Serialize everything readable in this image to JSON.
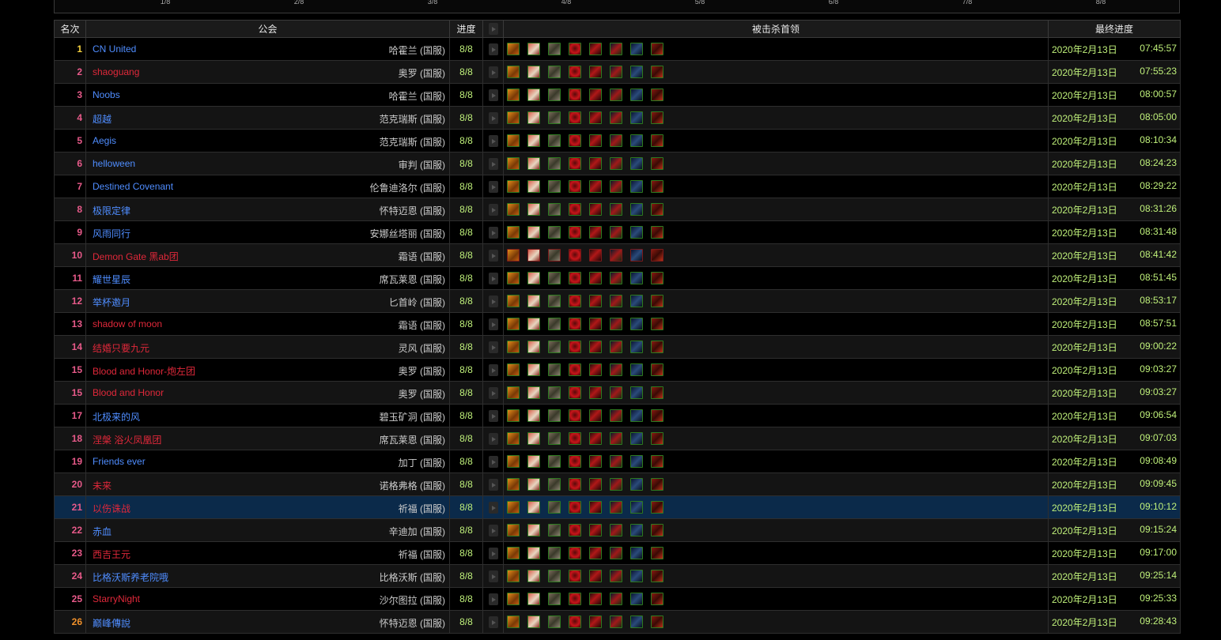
{
  "progress_labels": [
    "1/8",
    "2/8",
    "3/8",
    "4/8",
    "5/8",
    "6/8",
    "7/8",
    "8/8"
  ],
  "headers": {
    "rank": "名次",
    "guild": "公会",
    "progress": "进度",
    "video_icon": "youtube-icon",
    "bosses": "被击杀首领",
    "final": "最终进度"
  },
  "colors": {
    "alliance": "#4f8dff",
    "horde": "#e0283a",
    "progress": "#bff07a",
    "highlight_row": "#0b2a4a"
  },
  "boss_icon_names": [
    "boss-1-icon",
    "boss-2-icon",
    "boss-3-icon",
    "boss-4-icon",
    "boss-5-icon",
    "boss-6-icon",
    "boss-7-icon",
    "boss-8-icon"
  ],
  "rows": [
    {
      "rank": "1",
      "rank_color": "#f4d03f",
      "guild": "CN United",
      "faction": "alliance",
      "realm": "哈霍兰 (国服)",
      "progress": "8/8",
      "date": "2020年2月13日",
      "time": "07:45:57"
    },
    {
      "rank": "2",
      "rank_color": "#e85a8a",
      "guild": "shaoguang",
      "faction": "horde",
      "realm": "奥罗 (国服)",
      "progress": "8/8",
      "date": "2020年2月13日",
      "time": "07:55:23"
    },
    {
      "rank": "3",
      "rank_color": "#e85a8a",
      "guild": "Noobs",
      "faction": "alliance",
      "realm": "哈霍兰 (国服)",
      "progress": "8/8",
      "date": "2020年2月13日",
      "time": "08:00:57"
    },
    {
      "rank": "4",
      "rank_color": "#e85a8a",
      "guild": "超越",
      "faction": "alliance",
      "realm": "范克瑞斯 (国服)",
      "progress": "8/8",
      "date": "2020年2月13日",
      "time": "08:05:00"
    },
    {
      "rank": "5",
      "rank_color": "#e85a8a",
      "guild": "Aegis",
      "faction": "alliance",
      "realm": "范克瑞斯 (国服)",
      "progress": "8/8",
      "date": "2020年2月13日",
      "time": "08:10:34"
    },
    {
      "rank": "6",
      "rank_color": "#e85a8a",
      "guild": "helloween",
      "faction": "alliance",
      "realm": "审判 (国服)",
      "progress": "8/8",
      "date": "2020年2月13日",
      "time": "08:24:23"
    },
    {
      "rank": "7",
      "rank_color": "#e85a8a",
      "guild": "Destined Covenant",
      "faction": "alliance",
      "realm": "伦鲁迪洛尔 (国服)",
      "progress": "8/8",
      "date": "2020年2月13日",
      "time": "08:29:22"
    },
    {
      "rank": "8",
      "rank_color": "#e85a8a",
      "guild": "极限定律",
      "faction": "alliance",
      "realm": "怀特迈恩 (国服)",
      "progress": "8/8",
      "date": "2020年2月13日",
      "time": "08:31:26"
    },
    {
      "rank": "9",
      "rank_color": "#e85a8a",
      "guild": "风雨同行",
      "faction": "alliance",
      "realm": "安娜丝塔丽 (国服)",
      "progress": "8/8",
      "date": "2020年2月13日",
      "time": "08:31:48"
    },
    {
      "rank": "10",
      "rank_color": "#e85a8a",
      "guild": "Demon Gate 黑ab团",
      "faction": "horde",
      "realm": "霜语 (国服)",
      "progress": "8/8",
      "date": "2020年2月13日",
      "time": "08:41:42"
    },
    {
      "rank": "11",
      "rank_color": "#e85a8a",
      "guild": "耀世星辰",
      "faction": "alliance",
      "realm": "席瓦莱恩 (国服)",
      "progress": "8/8",
      "date": "2020年2月13日",
      "time": "08:51:45"
    },
    {
      "rank": "12",
      "rank_color": "#e85a8a",
      "guild": "举杯邀月",
      "faction": "alliance",
      "realm": "匕首岭 (国服)",
      "progress": "8/8",
      "date": "2020年2月13日",
      "time": "08:53:17"
    },
    {
      "rank": "13",
      "rank_color": "#e85a8a",
      "guild": "shadow of moon",
      "faction": "horde",
      "realm": "霜语 (国服)",
      "progress": "8/8",
      "date": "2020年2月13日",
      "time": "08:57:51"
    },
    {
      "rank": "14",
      "rank_color": "#e85a8a",
      "guild": "结婚只要九元",
      "faction": "horde",
      "realm": "灵风 (国服)",
      "progress": "8/8",
      "date": "2020年2月13日",
      "time": "09:00:22"
    },
    {
      "rank": "15",
      "rank_color": "#e85a8a",
      "guild": "Blood and Honor-炮左团",
      "faction": "horde",
      "realm": "奥罗 (国服)",
      "progress": "8/8",
      "date": "2020年2月13日",
      "time": "09:03:27"
    },
    {
      "rank": "15",
      "rank_color": "#e85a8a",
      "guild": "Blood and Honor",
      "faction": "horde",
      "realm": "奥罗 (国服)",
      "progress": "8/8",
      "date": "2020年2月13日",
      "time": "09:03:27"
    },
    {
      "rank": "17",
      "rank_color": "#e85a8a",
      "guild": "北极来的风",
      "faction": "alliance",
      "realm": "碧玉矿洞 (国服)",
      "progress": "8/8",
      "date": "2020年2月13日",
      "time": "09:06:54"
    },
    {
      "rank": "18",
      "rank_color": "#e85a8a",
      "guild": "涅槃 浴火凤凰团",
      "faction": "horde",
      "realm": "席瓦莱恩 (国服)",
      "progress": "8/8",
      "date": "2020年2月13日",
      "time": "09:07:03"
    },
    {
      "rank": "19",
      "rank_color": "#e85a8a",
      "guild": "Friends ever",
      "faction": "alliance",
      "realm": "加丁 (国服)",
      "progress": "8/8",
      "date": "2020年2月13日",
      "time": "09:08:49"
    },
    {
      "rank": "20",
      "rank_color": "#e85a8a",
      "guild": "未来",
      "faction": "horde",
      "realm": "诺格弗格 (国服)",
      "progress": "8/8",
      "date": "2020年2月13日",
      "time": "09:09:45"
    },
    {
      "rank": "21",
      "rank_color": "#e85a8a",
      "guild": "以伤诛战",
      "faction": "horde",
      "realm": "祈福 (国服)",
      "progress": "8/8",
      "date": "2020年2月13日",
      "time": "09:10:12",
      "highlight": true
    },
    {
      "rank": "22",
      "rank_color": "#e85a8a",
      "guild": "赤血",
      "faction": "alliance",
      "realm": "辛迪加 (国服)",
      "progress": "8/8",
      "date": "2020年2月13日",
      "time": "09:15:24"
    },
    {
      "rank": "23",
      "rank_color": "#e85a8a",
      "guild": "西吉王元",
      "faction": "horde",
      "realm": "祈福 (国服)",
      "progress": "8/8",
      "date": "2020年2月13日",
      "time": "09:17:00"
    },
    {
      "rank": "24",
      "rank_color": "#e85a8a",
      "guild": "比格沃斯养老院哦",
      "faction": "alliance",
      "realm": "比格沃斯 (国服)",
      "progress": "8/8",
      "date": "2020年2月13日",
      "time": "09:25:14"
    },
    {
      "rank": "25",
      "rank_color": "#e85a8a",
      "guild": "StarryNight",
      "faction": "horde",
      "realm": "沙尔图拉 (国服)",
      "progress": "8/8",
      "date": "2020年2月13日",
      "time": "09:25:33"
    },
    {
      "rank": "26",
      "rank_color": "#f0902a",
      "guild": "巅峰傳說",
      "faction": "alliance",
      "realm": "怀特迈恩 (国服)",
      "progress": "8/8",
      "date": "2020年2月13日",
      "time": "09:28:43"
    }
  ]
}
